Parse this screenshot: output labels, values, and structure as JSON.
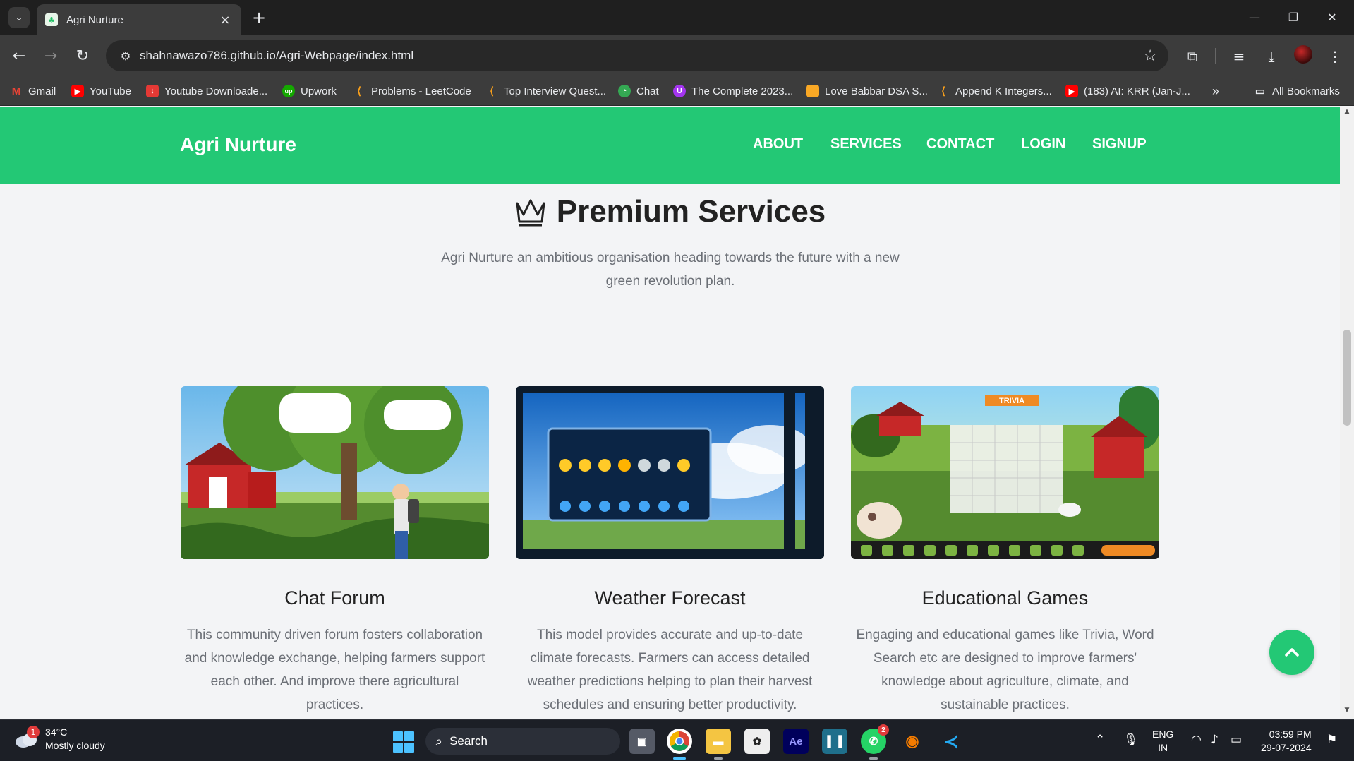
{
  "browser": {
    "tab_title": "Agri Nurture",
    "url": "shahnawazo786.github.io/Agri-Webpage/index.html",
    "bookmarks": [
      {
        "label": "Gmail",
        "icon": "gmail-icon",
        "color": "#ea4335"
      },
      {
        "label": "YouTube",
        "icon": "youtube-icon",
        "color": "#ff0000"
      },
      {
        "label": "Youtube Downloade...",
        "icon": "download-arrow-icon",
        "color": "#e53935"
      },
      {
        "label": "Upwork",
        "icon": "upwork-icon",
        "color": "#14a800"
      },
      {
        "label": "Problems - LeetCode",
        "icon": "leetcode-icon",
        "color": "#f89f1b"
      },
      {
        "label": "Top Interview Quest...",
        "icon": "leetcode-icon",
        "color": "#f89f1b"
      },
      {
        "label": "Chat",
        "icon": "chat-icon",
        "color": "#34a853"
      },
      {
        "label": "The Complete 2023...",
        "icon": "udemy-icon",
        "color": "#a435f0"
      },
      {
        "label": "Love Babbar DSA S...",
        "icon": "bookmark-orange-icon",
        "color": "#f9a825"
      },
      {
        "label": "Append K Integers...",
        "icon": "leetcode-icon",
        "color": "#f89f1b"
      },
      {
        "label": "(183) AI: KRR (Jan-J...",
        "icon": "youtube-icon",
        "color": "#ff0000"
      }
    ],
    "all_bookmarks_label": "All Bookmarks",
    "more_label": "»"
  },
  "page": {
    "brand": "Agri Nurture",
    "nav": [
      "ABOUT",
      "SERVICES",
      "CONTACT",
      "LOGIN",
      "SIGNUP"
    ],
    "section_title": "Premium Services",
    "section_subtitle": "Agri Nurture an ambitious organisation heading towards the future with a new green revolution plan.",
    "cards": [
      {
        "title": "Chat Forum",
        "text": "This community driven forum fosters collaboration and knowledge exchange, helping farmers support each other. And improve there agricultural practices.",
        "image": "farm-chat-illustration"
      },
      {
        "title": "Weather Forecast",
        "text": "This model provides accurate and up-to-date climate forecasts. Farmers can access detailed weather predictions helping to plan their harvest schedules and ensuring better productivity.",
        "image": "weather-screen-illustration"
      },
      {
        "title": "Educational Games",
        "text": "Engaging and educational games like Trivia, Word Search etc are designed to improve farmers' knowledge about agriculture, climate, and sustainable practices.",
        "image": "farm-trivia-illustration",
        "image_banner": "TRIVIA"
      }
    ],
    "accent_color": "#23c875"
  },
  "taskbar": {
    "weather_temp": "34°C",
    "weather_desc": "Mostly cloudy",
    "weather_badge": "1",
    "search_label": "Search",
    "whatsapp_badge": "2",
    "lang_1": "ENG",
    "lang_2": "IN",
    "time": "03:59 PM",
    "date": "29-07-2024"
  }
}
